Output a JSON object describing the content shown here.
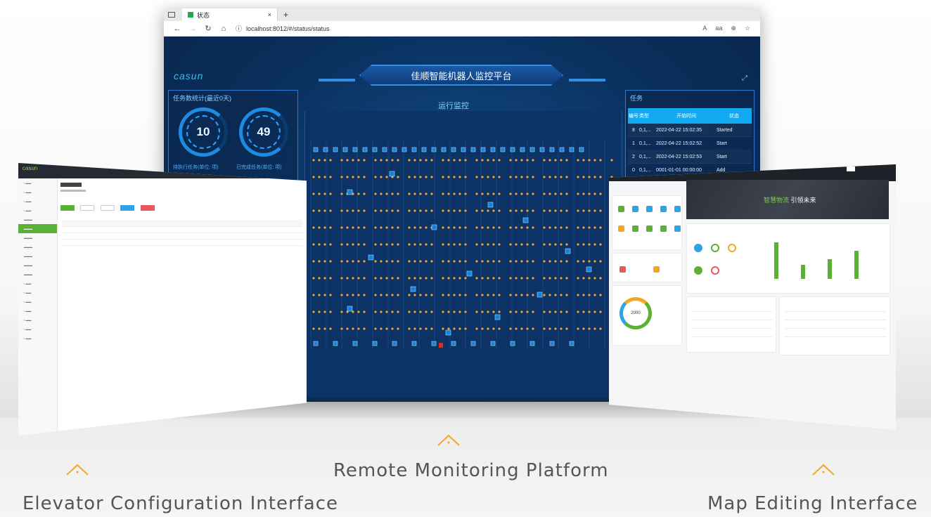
{
  "browser": {
    "tab_title": "状态",
    "tab_close": "×",
    "new_tab": "+",
    "url": "localhost:8012/#/status/status",
    "nav_icons": [
      "back-icon",
      "forward-icon",
      "refresh-icon",
      "home-icon"
    ],
    "tool_icons": [
      "read-aloud-icon",
      "immersive-reader-icon",
      "zoom-icon",
      "favorites-icon"
    ]
  },
  "dashboard": {
    "logo": "casun",
    "title": "佳顺智能机器人监控平台",
    "left_panel": {
      "title": "任务数统计(最近0天)",
      "pending_value": "10",
      "pending_label": "待执行任务(单位: 项)",
      "done_value": "49",
      "done_label": "已完成任务(单位: 项)"
    },
    "center_title": "运行监控",
    "task_panel": {
      "title": "任务",
      "headers": [
        "编号",
        "类型",
        "开始时间",
        "状态"
      ],
      "rows": [
        {
          "id": "8",
          "type": "0,1,...",
          "time": "2022-04-22 15:02:35",
          "status": "Started"
        },
        {
          "id": "1",
          "type": "0,1,...",
          "time": "2022-04-22 15:02:52",
          "status": "Start"
        },
        {
          "id": "2",
          "type": "0,1,...",
          "time": "2022-04-22 15:02:53",
          "status": "Start"
        },
        {
          "id": "0",
          "type": "0,1,...",
          "time": "0001-01-01 00:00:00",
          "status": "Add"
        }
      ]
    }
  },
  "left_screen": {
    "logo": "casun"
  },
  "right_screen": {
    "banner_text": "智慧物流 引领未来",
    "banner_highlight": "智慧物流",
    "banner_rest": "引领未来",
    "donut_value": "2000"
  },
  "captions": {
    "left": "Elevator Configuration Interface",
    "center": "Remote Monitoring Platform",
    "right": "Map Editing Interface"
  },
  "colors": {
    "accent_orange": "#f5a623",
    "dashboard_blue": "#0a2f5c",
    "highlight_cyan": "#11aaf0",
    "brand_green": "#5bb136"
  }
}
